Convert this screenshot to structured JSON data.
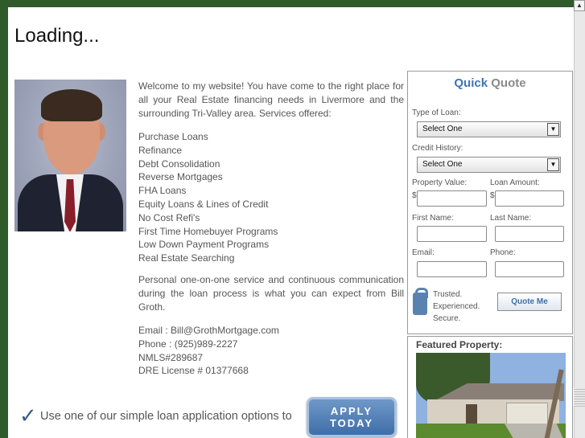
{
  "page": {
    "loading_text": "Loading..."
  },
  "intro": {
    "welcome": "Welcome to my website! You have come to the right place for all your Real Estate financing needs in Livermore and the surrounding Tri-Valley area. Services offered:",
    "services": [
      "Purchase Loans",
      "Refinance",
      "Debt Consolidation",
      "Reverse Mortgages",
      "FHA Loans",
      "Equity Loans & Lines of Credit",
      "No Cost Refi's",
      "First Time Homebuyer Programs",
      "Low Down Payment Programs",
      "Real Estate Searching"
    ],
    "personal": "Personal one-on-one service and continuous communication during the loan process is what you can expect from Bill Groth."
  },
  "contact": {
    "email": "Email : Bill@GrothMortgage.com",
    "phone": "Phone : (925)989-2227",
    "nmls": "NMLS#289687",
    "dre": "DRE License # 01377668"
  },
  "cta": {
    "text": "Use one of our simple loan application options to",
    "apply_line1": "APPLY",
    "apply_line2": "TODAY"
  },
  "quick_quote": {
    "title_part1": "Quick",
    "title_part2": "Quote",
    "type_of_loan_label": "Type of Loan:",
    "type_of_loan_value": "Select One",
    "credit_history_label": "Credit History:",
    "credit_history_value": "Select One",
    "property_value_label": "Property Value:",
    "loan_amount_label": "Loan Amount:",
    "currency_symbol": "$",
    "first_name_label": "First Name:",
    "last_name_label": "Last Name:",
    "email_label": "Email:",
    "phone_label": "Phone:",
    "trust_line1": "Trusted.",
    "trust_line2": "Experienced.",
    "trust_line3": "Secure.",
    "submit_label": "Quote Me"
  },
  "featured": {
    "title": "Featured Property:"
  },
  "colors": {
    "background": "#2f5a2a",
    "accent_blue": "#3f75b5",
    "text_gray": "#555555"
  }
}
